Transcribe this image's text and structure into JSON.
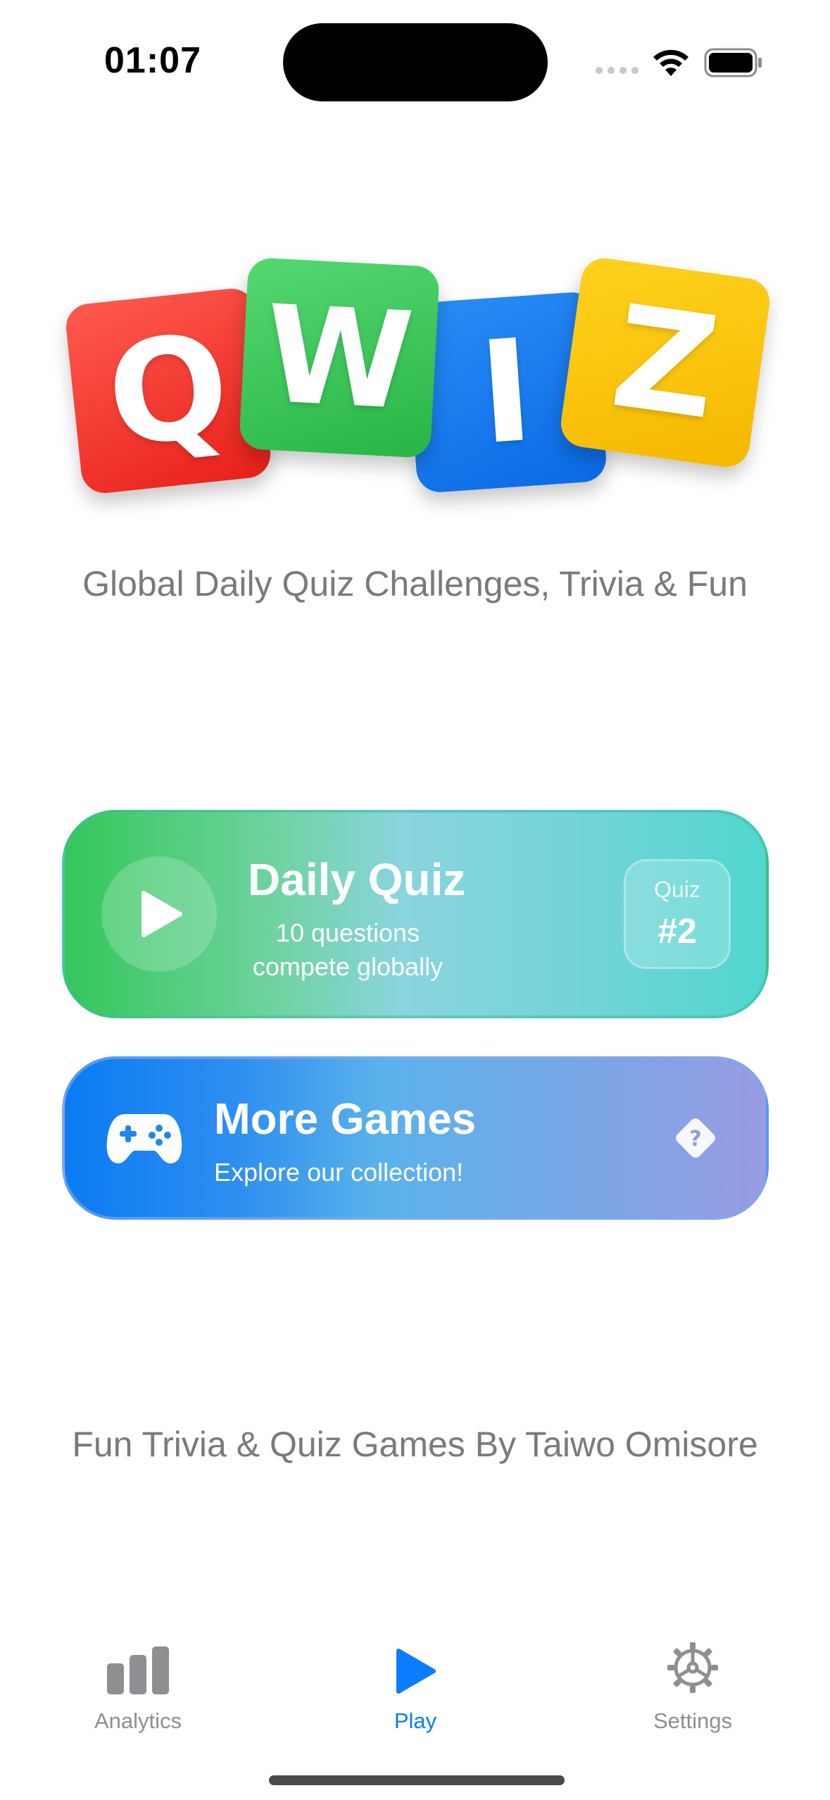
{
  "status_bar": {
    "time": "01:07",
    "wifi_icon": "wifi-icon",
    "battery_icon": "battery-icon"
  },
  "logo": {
    "letters": [
      "Q",
      "W",
      "I",
      "Z"
    ],
    "colors": [
      "#ff3b30",
      "#34c759",
      "#0a7bf2",
      "#ffcc00"
    ]
  },
  "tagline": "Global Daily Quiz Challenges, Trivia & Fun",
  "daily_quiz": {
    "title": "Daily Quiz",
    "subtitle_line1": "10 questions",
    "subtitle_line2": "compete globally",
    "badge_label": "Quiz",
    "badge_number": "#2",
    "icon": "play-icon"
  },
  "more_games": {
    "title": "More Games",
    "subtitle": "Explore our collection!",
    "icon": "gamepad-icon",
    "accessory_icon": "question-diamond-icon"
  },
  "footer": "Fun Trivia & Quiz Games By Taiwo Omisore",
  "tab_bar": {
    "active_color": "#0a7cff",
    "inactive_color": "#8e8e93",
    "tabs": [
      {
        "label": "Analytics",
        "icon": "bar-chart-icon"
      },
      {
        "label": "Play",
        "icon": "play-icon"
      },
      {
        "label": "Settings",
        "icon": "gear-icon"
      }
    ]
  }
}
